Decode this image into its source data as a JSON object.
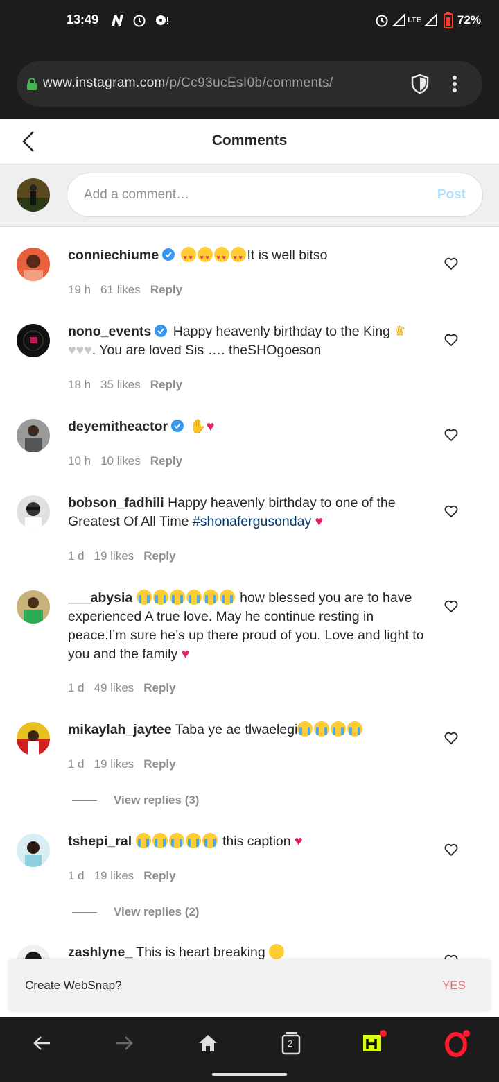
{
  "status_bar": {
    "time": "13:49",
    "battery": "72%",
    "network": "LTE"
  },
  "browser": {
    "url_domain": "www.instagram.com",
    "url_path": "/p/Cc93ucEsI0b/comments/"
  },
  "header": {
    "title": "Comments"
  },
  "add_comment": {
    "placeholder": "Add a comment…",
    "post_label": "Post"
  },
  "comments": [
    {
      "username": "conniechiume",
      "verified": true,
      "text": "It is well bitso",
      "time": "19 h",
      "likes": "61 likes",
      "reply": "Reply"
    },
    {
      "username": "nono_events",
      "verified": true,
      "text": "Happy heavenly birthday to the King",
      "text2": ". You are loved Sis …. theSHOgoeson",
      "time": "18 h",
      "likes": "35 likes",
      "reply": "Reply"
    },
    {
      "username": "deyemitheactor",
      "verified": true,
      "text": "",
      "time": "10 h",
      "likes": "10 likes",
      "reply": "Reply"
    },
    {
      "username": "bobson_fadhili",
      "verified": false,
      "text": "Happy heavenly birthday to one of the Greatest Of All Time",
      "hashtag": "#shonafergusonday",
      "time": "1 d",
      "likes": "19 likes",
      "reply": "Reply"
    },
    {
      "username": "___abysia",
      "verified": false,
      "text": "how blessed you are to have experienced A true love. May he continue resting in peace.I’m sure he’s up there proud of you. Love and light to you and the family",
      "time": "1 d",
      "likes": "49 likes",
      "reply": "Reply"
    },
    {
      "username": "mikaylah_jaytee",
      "verified": false,
      "text": "Taba ye ae tlwaelegi",
      "time": "1 d",
      "likes": "19 likes",
      "reply": "Reply",
      "view_replies": "View replies (3)"
    },
    {
      "username": "tshepi_ral",
      "verified": false,
      "text": "this caption",
      "time": "1 d",
      "likes": "19 likes",
      "reply": "Reply",
      "view_replies": "View replies (2)"
    },
    {
      "username": "zashlyne_",
      "verified": false,
      "text": "This is heart breaking"
    }
  ],
  "websnap": {
    "label": "Create WebSnap?",
    "yes": "YES"
  },
  "bottom_nav": {
    "tabs_count": "2"
  },
  "colors": {
    "link": "#00376b",
    "post_disabled": "#b2dffc",
    "muted": "#8e8e8e",
    "verified": "#3897f0",
    "yes": "#f07070",
    "opera_red": "#ff1b2d"
  }
}
